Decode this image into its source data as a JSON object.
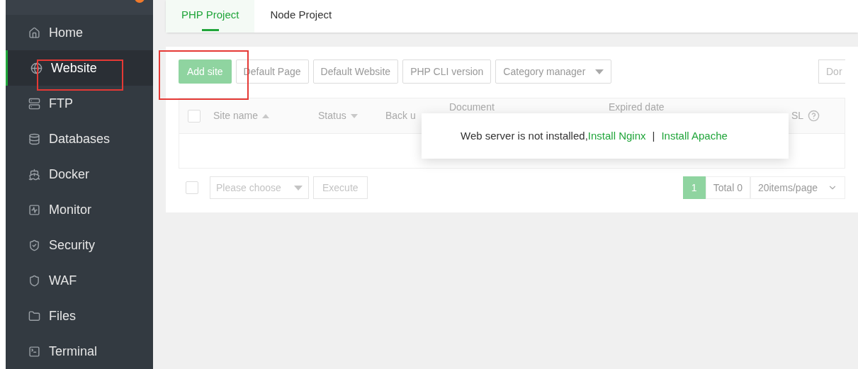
{
  "sidebar": {
    "items": [
      {
        "label": "Home",
        "selected": false
      },
      {
        "label": "Website",
        "selected": true
      },
      {
        "label": "FTP",
        "selected": false
      },
      {
        "label": "Databases",
        "selected": false
      },
      {
        "label": "Docker",
        "selected": false
      },
      {
        "label": "Monitor",
        "selected": false
      },
      {
        "label": "Security",
        "selected": false
      },
      {
        "label": "WAF",
        "selected": false
      },
      {
        "label": "Files",
        "selected": false
      },
      {
        "label": "Terminal",
        "selected": false
      }
    ]
  },
  "tabs": [
    {
      "label": "PHP Project",
      "selected": true
    },
    {
      "label": "Node Project",
      "selected": false
    }
  ],
  "toolbar": {
    "buttons": [
      {
        "label": "Add site",
        "kind": "primary"
      },
      {
        "label": "Default Page",
        "kind": "default"
      },
      {
        "label": "Default Website",
        "kind": "default"
      },
      {
        "label": "PHP CLI version",
        "kind": "default"
      },
      {
        "label": "Category manager",
        "kind": "dropdown"
      }
    ],
    "search": {
      "placeholder": "Dor"
    }
  },
  "table": {
    "select_all_checked": false,
    "columns": [
      {
        "label": "Site name",
        "kind": "asc"
      },
      {
        "label": "Status",
        "kind": "desc"
      },
      {
        "label": "Back u",
        "kind": "plain"
      },
      {
        "label": "Document",
        "kind": "plain"
      },
      {
        "label": "Expired date",
        "kind": "plain"
      },
      {
        "label": "SL",
        "kind": "help"
      }
    ]
  },
  "popup": {
    "message": "Web server is not installed,",
    "links": [
      "Install Nginx",
      "Install Apache"
    ],
    "separator": "|"
  },
  "footer": {
    "select_all_checked": false,
    "batch_placeholder": "Please choose",
    "execute": "Execute",
    "page": "1",
    "total": "Total 0",
    "page_size": "20items/page"
  }
}
